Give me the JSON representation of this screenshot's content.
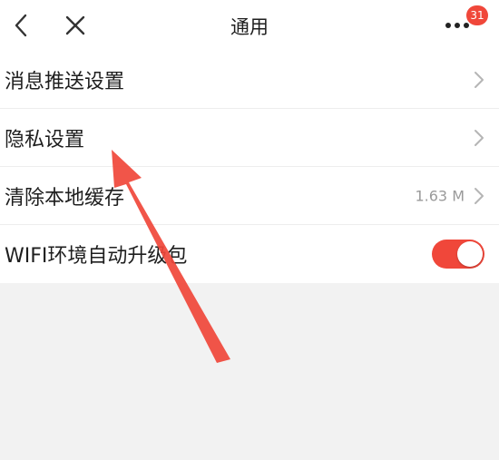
{
  "header": {
    "title": "通用",
    "badge_count": "31",
    "back_icon": "chevron-left-icon",
    "close_icon": "close-icon",
    "more_icon": "more-dots-icon"
  },
  "settings": {
    "items": [
      {
        "label": "消息推送设置"
      },
      {
        "label": "隐私设置"
      },
      {
        "label": "清除本地缓存",
        "value": "1.63 M"
      },
      {
        "label": "WIFI环境自动升级包"
      }
    ],
    "wifi_toggle_on": true
  },
  "annotation": {
    "arrow_icon": "red-arrow-annotation"
  },
  "colors": {
    "accent": "#f0473a",
    "background": "#f2f2f2",
    "surface": "#ffffff",
    "text": "#1e1e1e",
    "muted": "#9a9a9a"
  }
}
